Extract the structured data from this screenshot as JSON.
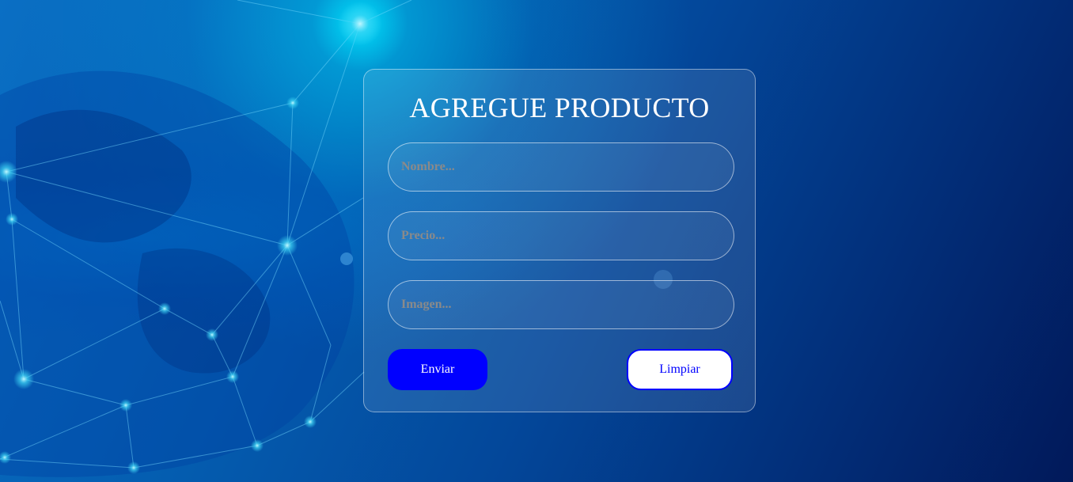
{
  "form": {
    "title": "AGREGUE PRODUCTO",
    "fields": {
      "nombre": {
        "value": "",
        "placeholder": "Nombre..."
      },
      "precio": {
        "value": "",
        "placeholder": "Precio..."
      },
      "imagen": {
        "value": "",
        "placeholder": "Imagen..."
      }
    },
    "buttons": {
      "send_label": "Enviar",
      "clear_label": "Limpiar"
    }
  },
  "colors": {
    "send_button_bg": "#0000ff",
    "clear_button_text": "#0000ff",
    "title_text": "#ffffff",
    "placeholder_text": "#8a8a8a"
  },
  "background": {
    "theme": "blue globe with network nodes"
  }
}
